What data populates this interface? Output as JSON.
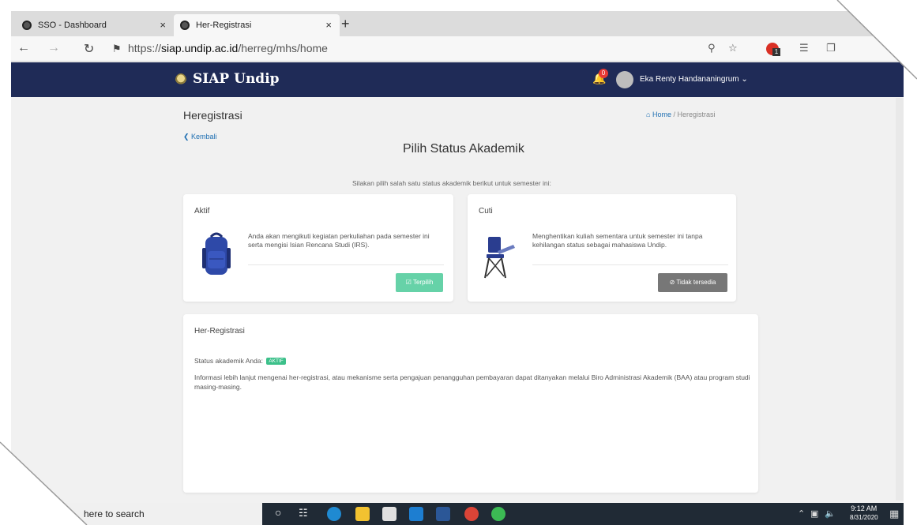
{
  "browser": {
    "tabs": [
      {
        "title": "SSO - Dashboard",
        "close": "×"
      },
      {
        "title": "Her-Registrasi",
        "close": "×"
      }
    ],
    "new_tab": "+",
    "url_prefix": "https://",
    "url_host": "siap.undip.ac.id",
    "url_path": "/herreg/mhs/home",
    "extension_badge": "1"
  },
  "header": {
    "brand": "SIAP Undip",
    "notifications_count": "0",
    "user_name": "Eka Renty Handananingrum ⌄"
  },
  "page": {
    "title": "Heregistrasi",
    "breadcrumb_home": "Home",
    "breadcrumb_sep": " / ",
    "breadcrumb_current": "Heregistrasi",
    "back_link": "❮ Kembali",
    "heading": "Pilih Status Akademik",
    "instruction": "Silakan pilih salah satu status akademik berikut untuk semester ini:"
  },
  "cards": {
    "aktif": {
      "title": "Aktif",
      "description": "Anda akan mengikuti kegiatan perkuliahan pada semester ini serta mengisi Isian Rencana Studi (IRS).",
      "button": "☑ Terpilih"
    },
    "cuti": {
      "title": "Cuti",
      "description": "Menghentikan kuliah sementara untuk semester ini tanpa kehilangan status sebagai mahasiswa Undip.",
      "button": "⊘ Tidak tersedia"
    }
  },
  "herreg": {
    "title": "Her-Registrasi",
    "status_label": "Status akademik Anda:",
    "status_value": "AKTIF",
    "info": "Informasi lebih lanjut mengenai her-registrasi, atau mekanisme serta pengajuan penangguhan pembayaran dapat ditanyakan melalui Biro Administrasi Akademik (BAA) atau program studi masing-masing."
  },
  "taskbar": {
    "search_placeholder": "here to search",
    "time": "9:12 AM",
    "date": "8/31/2020"
  },
  "colors": {
    "header_bg": "#1f2b57",
    "selected_button": "#66d2a8",
    "disabled_button": "#777777",
    "status_badge": "#3cc08a",
    "link": "#1f6fb2"
  }
}
